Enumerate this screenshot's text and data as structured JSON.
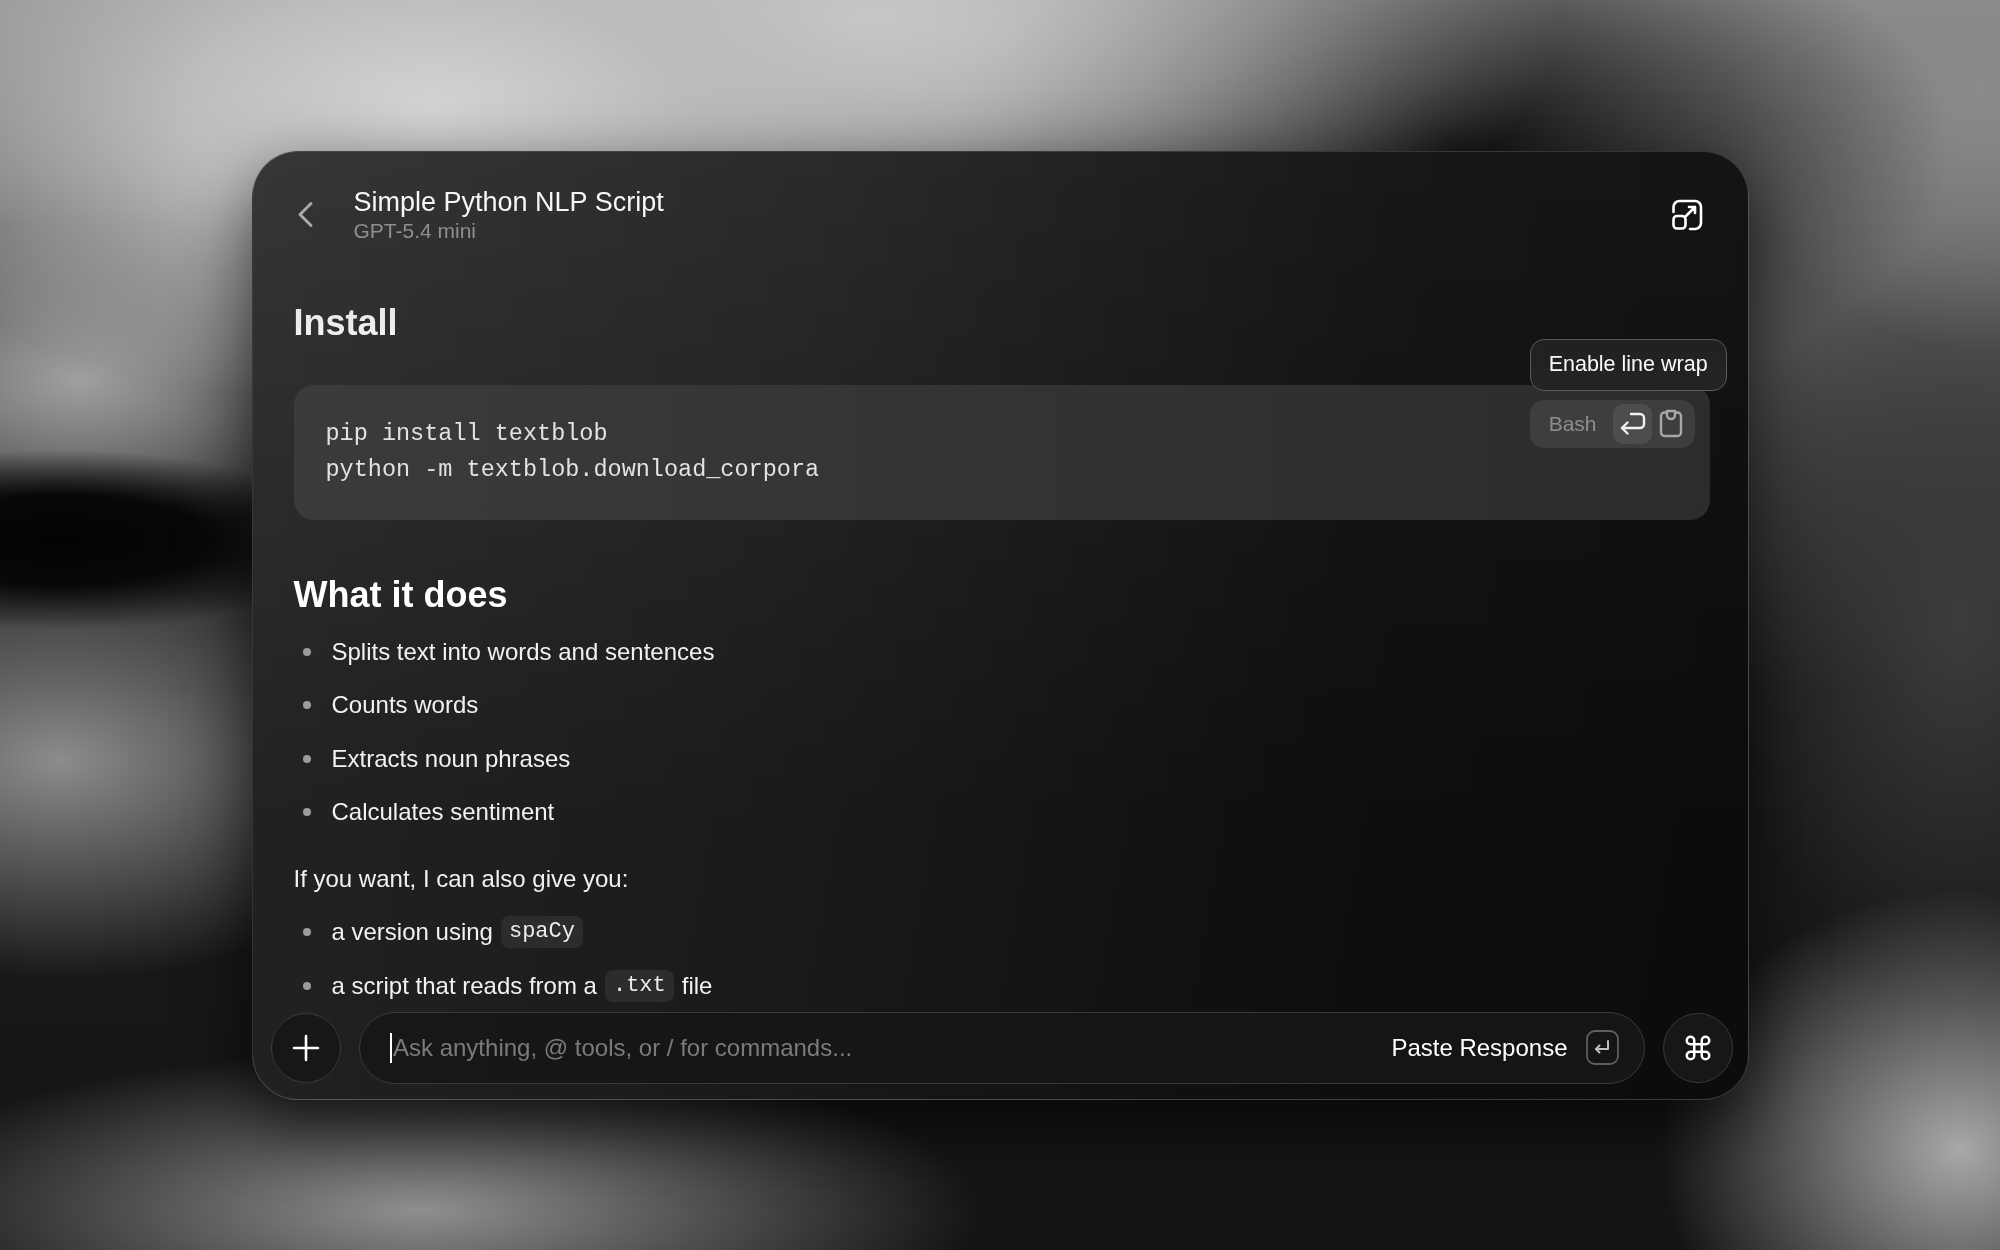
{
  "header": {
    "title": "Simple Python NLP Script",
    "subtitle": "GPT-5.4 mini"
  },
  "content": [
    {
      "kind": "heading",
      "text": "Install"
    },
    {
      "kind": "code_block",
      "language": "Bash",
      "lines": [
        "pip install textblob",
        "python -m textblob.download_corpora"
      ],
      "wrap_button": {
        "hovered": true,
        "tooltip": "Enable line wrap"
      }
    },
    {
      "kind": "heading",
      "text": "What it does"
    },
    {
      "kind": "bullets",
      "items": [
        [
          {
            "kind": "text",
            "text": "Splits text into words and sentences"
          }
        ],
        [
          {
            "kind": "text",
            "text": "Counts words"
          }
        ],
        [
          {
            "kind": "text",
            "text": "Extracts noun phrases"
          }
        ],
        [
          {
            "kind": "text",
            "text": "Calculates sentiment"
          }
        ]
      ]
    },
    {
      "kind": "paragraph",
      "text": "If you want, I can also give you:"
    },
    {
      "kind": "bullets",
      "items": [
        [
          {
            "kind": "text",
            "text": "a version using"
          },
          {
            "kind": "code",
            "text": "spaCy"
          }
        ],
        [
          {
            "kind": "text",
            "text": "a script that reads from a"
          },
          {
            "kind": "code",
            "text": ".txt"
          },
          {
            "kind": "text",
            "text": "file"
          }
        ]
      ]
    }
  ],
  "composer": {
    "placeholder": "Ask anything, @ tools, or / for commands...",
    "focused": true,
    "paste_button": "Paste Response"
  }
}
